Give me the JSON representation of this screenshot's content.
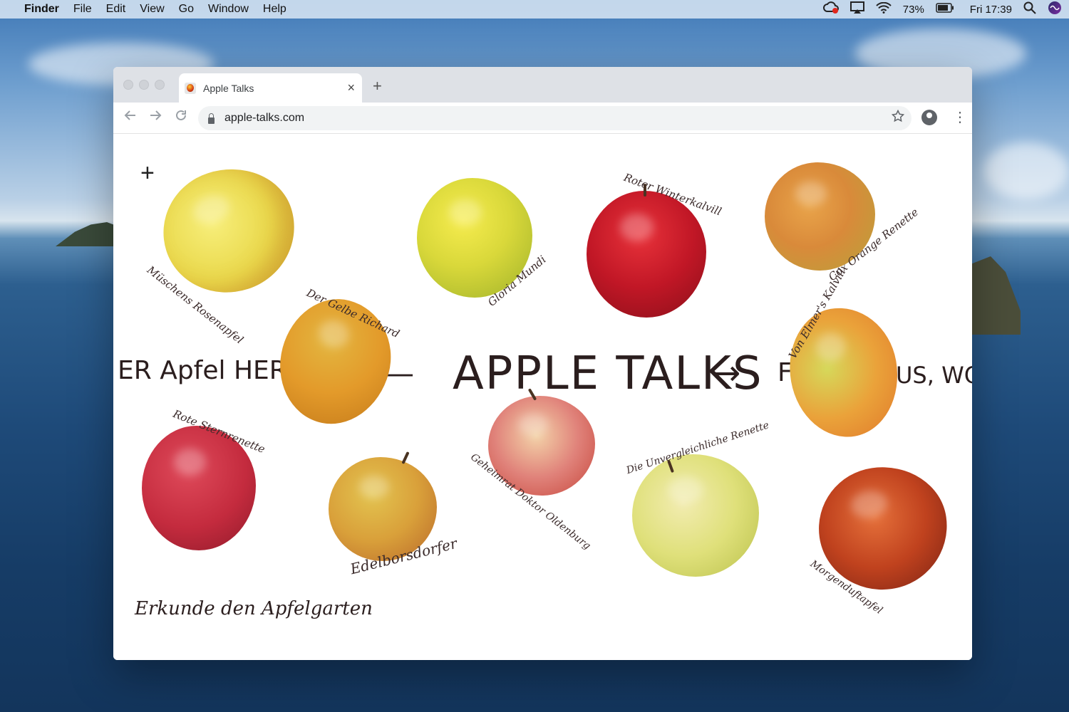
{
  "menubar": {
    "app_name": "Finder",
    "items": [
      "File",
      "Edit",
      "View",
      "Go",
      "Window",
      "Help"
    ],
    "battery_percent": "73%",
    "clock": "Fri 17:39"
  },
  "browser": {
    "tab_title": "Apple Talks",
    "tab_close": "×",
    "new_tab": "+",
    "url": "apple-talks.com"
  },
  "page": {
    "plus_button": "+",
    "title": "APPLE TALKS",
    "banner_left": "ER Apfel HERK",
    "arrow_mid": "—",
    "arrow_right": "→",
    "banner_right_start": "F",
    "banner_right_end": "US, WO",
    "explore_text": "Erkunde den Apfelgarten",
    "apples": [
      {
        "label": "Müschens Rosenapfel"
      },
      {
        "label": "Gloria Mundi"
      },
      {
        "label": "Roter Winterkalvill"
      },
      {
        "label": "Cox Orange Renette"
      },
      {
        "label": "Der Gelbe Richard"
      },
      {
        "label": "Von Elmer's Kalvill"
      },
      {
        "label": "Rote Sternrenette"
      },
      {
        "label": "Geheimrat Doktor Oldenburg"
      },
      {
        "label": "Edelborsdorfer"
      },
      {
        "label": "Die Unvergleichliche Renette"
      },
      {
        "label": "Morgenduftapfel"
      }
    ]
  }
}
